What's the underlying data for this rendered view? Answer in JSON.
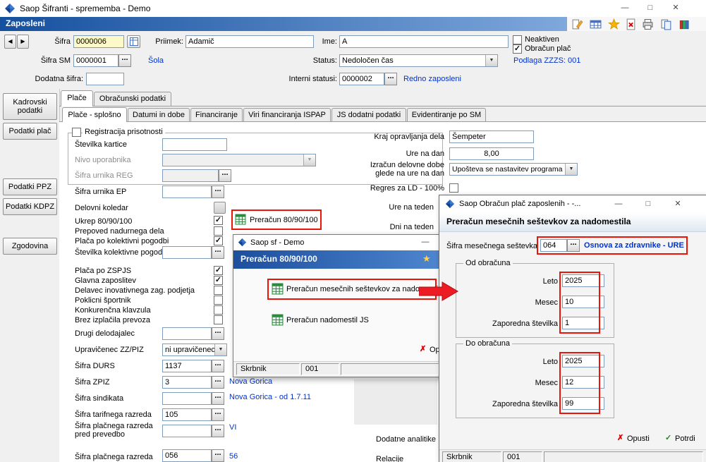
{
  "ui": {
    "dots": "...",
    "check": "✓",
    "cross": "✗",
    "star": "★",
    "arrow_down": "▼",
    "minimize": "—",
    "maximize": "□",
    "close": "✕",
    "prev": "◀",
    "next": "▶"
  },
  "window": {
    "title": "Saop Šifranti - sprememba - Demo"
  },
  "ribbon": {
    "section_title": "Zaposleni"
  },
  "header": {
    "sifra_label": "Šifra",
    "sifra_value": "0000006",
    "priimek_label": "Priimek:",
    "priimek_value": "Adamič",
    "ime_label": "Ime:",
    "ime_value": "A",
    "neaktiven_label": "Neaktiven",
    "obracun_plac_label": "Obračun plač",
    "sifra_sm_label": "Šifra SM",
    "sifra_sm_value": "0000001",
    "sifra_sm_desc": "Šola",
    "status_label": "Status:",
    "status_value": "Nedoločen čas",
    "podlaga_zzzs": "Podlaga ZZZS: 001",
    "dodatna_sifra_label": "Dodatna šifra:",
    "interni_label": "Interni statusi:",
    "interni_value": "0000002",
    "interni_desc": "Redno zaposleni"
  },
  "sidebar": {
    "items": [
      {
        "label": "Kadrovski podatki"
      },
      {
        "label": "Podatki plač"
      },
      {
        "label": "Podatki PPZ"
      },
      {
        "label": "Podatki KDPZ"
      },
      {
        "label": "Zgodovina"
      }
    ]
  },
  "tabs": {
    "main": [
      {
        "label": "Plače"
      },
      {
        "label": "Obračunski podatki"
      }
    ],
    "sub": [
      {
        "label": "Plače - splošno"
      },
      {
        "label": "Datumi in dobe"
      },
      {
        "label": "Financiranje"
      },
      {
        "label": "Viri financiranja ISPAP"
      },
      {
        "label": "JS dodatni podatki"
      },
      {
        "label": "Evidentiranje po SM"
      }
    ]
  },
  "form": {
    "registracija_legend": "Registracija prisotnosti",
    "stevilka_kartice_label": "Številka kartice",
    "nivo_uporabnika_label": "Nivo uporabnika",
    "sifra_urnika_reg_label": "Šifra urnika REG",
    "sifra_urnika_ep_label": "Šifra urnika EP",
    "delovni_koledar_label": "Delovni koledar",
    "ukrep_label": "Ukrep 80/90/100",
    "preracun_button": "Preračun 80/90/100",
    "prepoved_label": "Prepoved nadurnega dela",
    "kolektivna_label": "Plača po kolektivni pogodbi",
    "stevilka_kolektivne_label": "Številka kolektivne pogodbe",
    "zspjs_label": "Plača po ZSPJS",
    "glavna_label": "Glavna zaposlitev",
    "delavec_label": "Delavec inovativnega zag. podjetja",
    "sportnik_label": "Poklicni športnik",
    "klavzula_label": "Konkurenčna klavzula",
    "prevoz_label": "Brez izplačila prevoza",
    "drugi_label": "Drugi delodajalec",
    "upravicenec_label": "Upravičenec ZZ/PIZ",
    "upravicenec_value": "ni upravičenec",
    "durs_label": "Šifra DURS",
    "durs_value": "1137",
    "durs_desc": "Nova Gorica",
    "zpiz_label": "Šifra ZPIZ",
    "zpiz_value": "3",
    "zpiz_desc": "Nova Gorica - od 1.7.11",
    "sindikat_label": "Šifra sindikata",
    "tarifni_label": "Šifra tarifnega razreda",
    "tarifni_value": "105",
    "tarifni_desc": "VI",
    "placni_pred_label_1": "Šifra plačnega razreda",
    "placni_pred_label_2": "pred prevedbo",
    "placni_label": "Šifra plačnega razreda",
    "placni_value": "056",
    "placni_desc": "56",
    "kraj_label": "Kraj opravljanja dela",
    "kraj_value": "Šempeter",
    "ure_dan_label": "Ure na dan",
    "ure_dan_value": "8,00",
    "izracun_label_1": "Izračun delovne dobe",
    "izracun_label_2": "glede na ure na dan",
    "izracun_value": "Upošteva se nastavitev programa",
    "regres_label": "Regres za LD - 100%",
    "ure_teden_label": "Ure na teden",
    "dni_teden_label": "Dni na teden",
    "dodatne_label": "Dodatne analitike",
    "relacije_label": "Relacije"
  },
  "dialog1": {
    "title": "Saop sf - Demo",
    "header": "Preračun 80/90/100",
    "item1": "Preračun mesečnih seštevkov za nadomestila",
    "item2": "Preračun nadomestil JS",
    "opusti": "Opusti",
    "status_user": "Skrbnik",
    "status_code": "001"
  },
  "dialog2": {
    "title": "Saop Obračun plač zaposlenih -  -...",
    "header": "Preračun mesečnih seštevkov za nadomestila",
    "sestevek_label": "Šifra mesečnega seštevka",
    "sestevek_value": "064",
    "sestevek_desc": "Osnova za zdravnike - URE",
    "od_legend": "Od obračuna",
    "do_legend": "Do obračuna",
    "leto_label": "Leto",
    "mesec_label": "Mesec",
    "zap_label": "Zaporedna številka",
    "od_leto": "2025",
    "od_mesec": "10",
    "od_zap": "1",
    "do_leto": "2025",
    "do_mesec": "12",
    "do_zap": "99",
    "opusti": "Opusti",
    "potrdi": "Potrdi",
    "status_user": "Skrbnik",
    "status_code": "001"
  }
}
